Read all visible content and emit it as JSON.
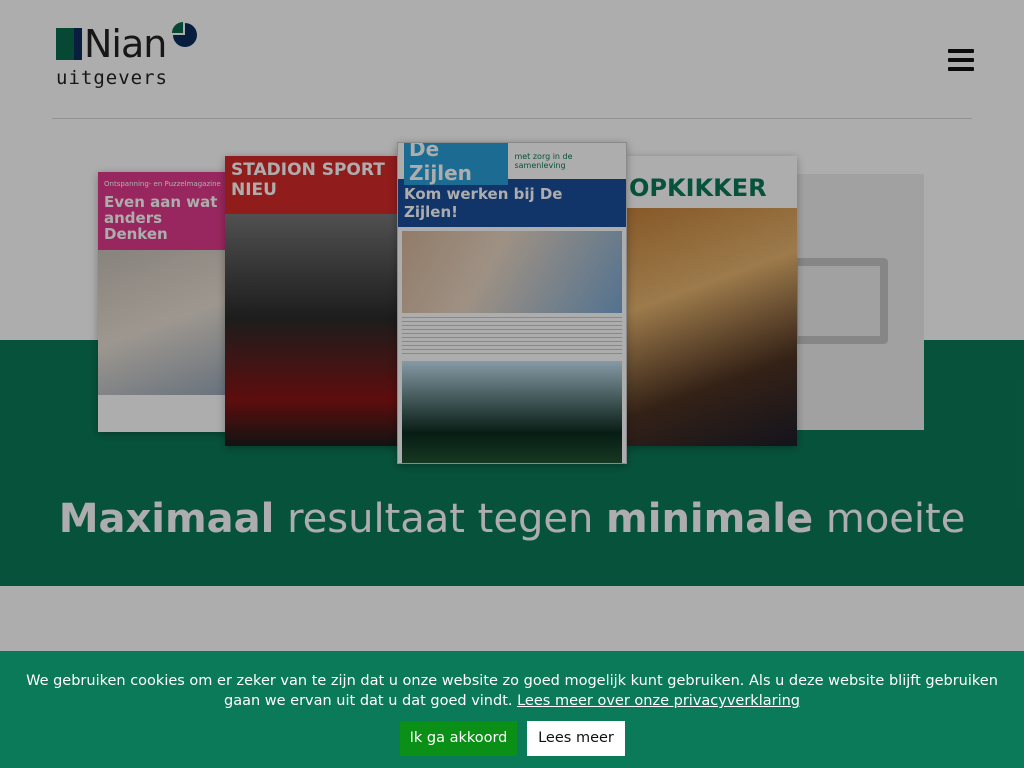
{
  "header": {
    "logo": {
      "word": "Nian",
      "sub": "uitgevers"
    },
    "menu_icon": "hamburger-icon"
  },
  "hero": {
    "magazines": [
      {
        "name": "puzzelmagazine",
        "small": "Ontspanning- en Puzzelmagazine",
        "title": "Even aan wat anders Denken"
      },
      {
        "name": "stadion-sport",
        "title": "STADION SPORT NIEU"
      },
      {
        "name": "de-zijlen",
        "brand": "De Zijlen",
        "tag": "met zorg in de samenleving",
        "headline": "Kom werken bij De Zijlen!"
      },
      {
        "name": "opkikker",
        "title": "OPKIKKER"
      }
    ],
    "tagline": {
      "bold1": "Maximaal",
      "normal1": " resultaat tegen ",
      "bold2": "minimale",
      "normal2": " moeite"
    }
  },
  "cookie": {
    "text": "We gebruiken cookies om er zeker van te zijn dat u onze website zo goed mogelijk kunt gebruiken. Als u deze website blijft gebruiken gaan we ervan uit dat u dat goed vindt.",
    "link": "Lees meer over onze privacyverklaring",
    "accept": "Ik ga akkoord",
    "more": "Lees meer"
  },
  "colors": {
    "brand_green": "#0b7a58",
    "accept_green": "#0a8f17"
  }
}
